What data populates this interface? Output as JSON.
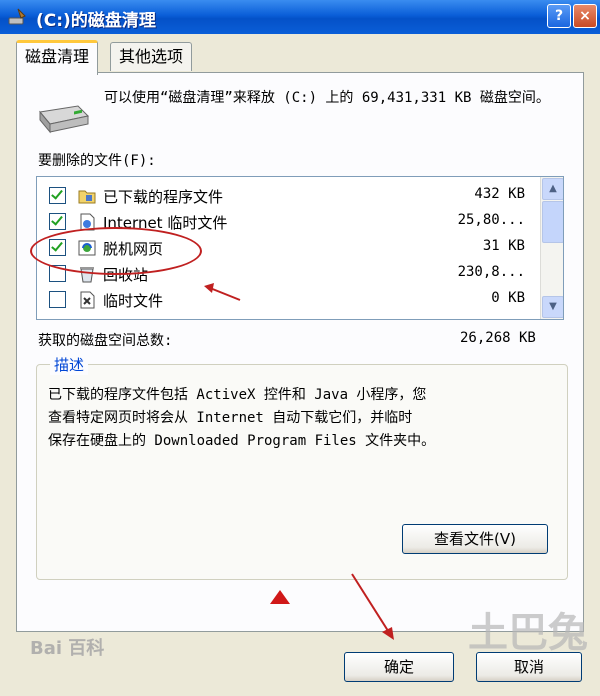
{
  "window": {
    "title": "(C:)的磁盘清理",
    "help_label": "?",
    "close_label": "×"
  },
  "tabs": [
    {
      "label": "磁盘清理",
      "active": true
    },
    {
      "label": "其他选项",
      "active": false
    }
  ],
  "summary": {
    "text": "可以使用“磁盘清理”来释放 (C:) 上的 69,431,331 KB 磁盘空间。"
  },
  "files_label": "要删除的文件(F):",
  "files": [
    {
      "name": "已下载的程序文件",
      "size": "432 KB",
      "checked": true,
      "icon": "folder-program-icon"
    },
    {
      "name": "Internet 临时文件",
      "size": "25,80...",
      "checked": true,
      "icon": "internet-page-icon"
    },
    {
      "name": "脱机网页",
      "size": "31 KB",
      "checked": true,
      "icon": "offline-page-icon"
    },
    {
      "name": "回收站",
      "size": "230,8...",
      "checked": false,
      "icon": "recycle-bin-icon"
    },
    {
      "name": "临时文件",
      "size": "0 KB",
      "checked": false,
      "icon": "temp-file-icon"
    }
  ],
  "total": {
    "label": "获取的磁盘空间总数:",
    "value": "26,268 KB"
  },
  "description": {
    "title": "描述",
    "text": "已下载的程序文件包括 ActiveX 控件和 Java 小程序，您\n查看特定网页时将会从 Internet 自动下载它们，并临时\n保存在硬盘上的 Downloaded Program Files 文件夹中。",
    "view_files_label": "查看文件(V)"
  },
  "buttons": {
    "ok_label": "确定",
    "cancel_label": "取消"
  },
  "watermarks": {
    "baidu": "Bai 百科",
    "tb": "土巴兔"
  },
  "colors": {
    "titlebar": "#0a5ed8",
    "annotation": "#c02020",
    "group_title": "#0046d5"
  }
}
